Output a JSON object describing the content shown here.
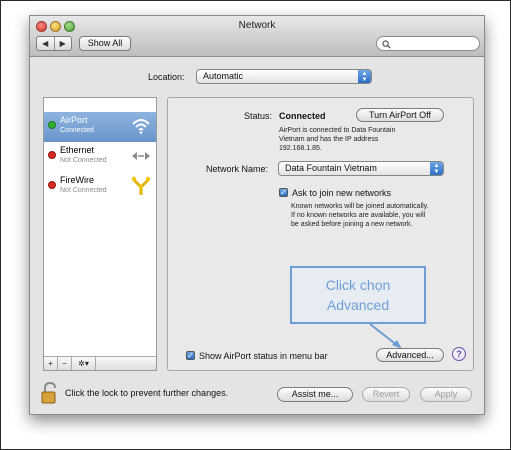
{
  "window": {
    "title": "Network"
  },
  "toolbar": {
    "back_label": "◀",
    "forward_label": "▶",
    "show_all_label": "Show All",
    "search_placeholder": ""
  },
  "location": {
    "label": "Location:",
    "value": "Automatic"
  },
  "services": [
    {
      "name": "AirPort",
      "status": "Connected",
      "status_color": "#2fb12f",
      "icon": "wifi-icon",
      "selected": true
    },
    {
      "name": "Ethernet",
      "status": "Not Connected",
      "status_color": "#d42a22",
      "icon": "ethernet-icon",
      "selected": false
    },
    {
      "name": "FireWire",
      "status": "Not Connected",
      "status_color": "#d42a22",
      "icon": "firewire-icon",
      "selected": false
    }
  ],
  "sidebar_footer": {
    "add_label": "+",
    "remove_label": "−",
    "action_label": "✲▾"
  },
  "panel": {
    "status_label": "Status:",
    "status_value": "Connected",
    "turn_off_label": "Turn AirPort Off",
    "status_desc_1": "AirPort is connected to Data Fountain",
    "status_desc_2": "Vietnam and has the IP address",
    "status_desc_3": "192.168.1.85.",
    "network_name_label": "Network Name:",
    "network_name_value": "Data Fountain Vietnam",
    "ask_label": "Ask to join new networks",
    "ask_desc_1": "Known networks will be joined automatically.",
    "ask_desc_2": "If no known networks are available, you will",
    "ask_desc_3": "be asked before joining a new network.",
    "callout_line1": "Click chọn",
    "callout_line2": "Advanced",
    "show_status_label": "Show AirPort status in menu bar",
    "advanced_label": "Advanced...",
    "help_label": "?"
  },
  "footer": {
    "lock_text": "Click the lock to prevent further changes.",
    "assist_label": "Assist me...",
    "revert_label": "Revert",
    "apply_label": "Apply"
  },
  "colors": {
    "accent": "#3a7bd5",
    "callout": "#6f9ed6",
    "connected": "#2fb12f",
    "disconnected": "#d42a22"
  }
}
